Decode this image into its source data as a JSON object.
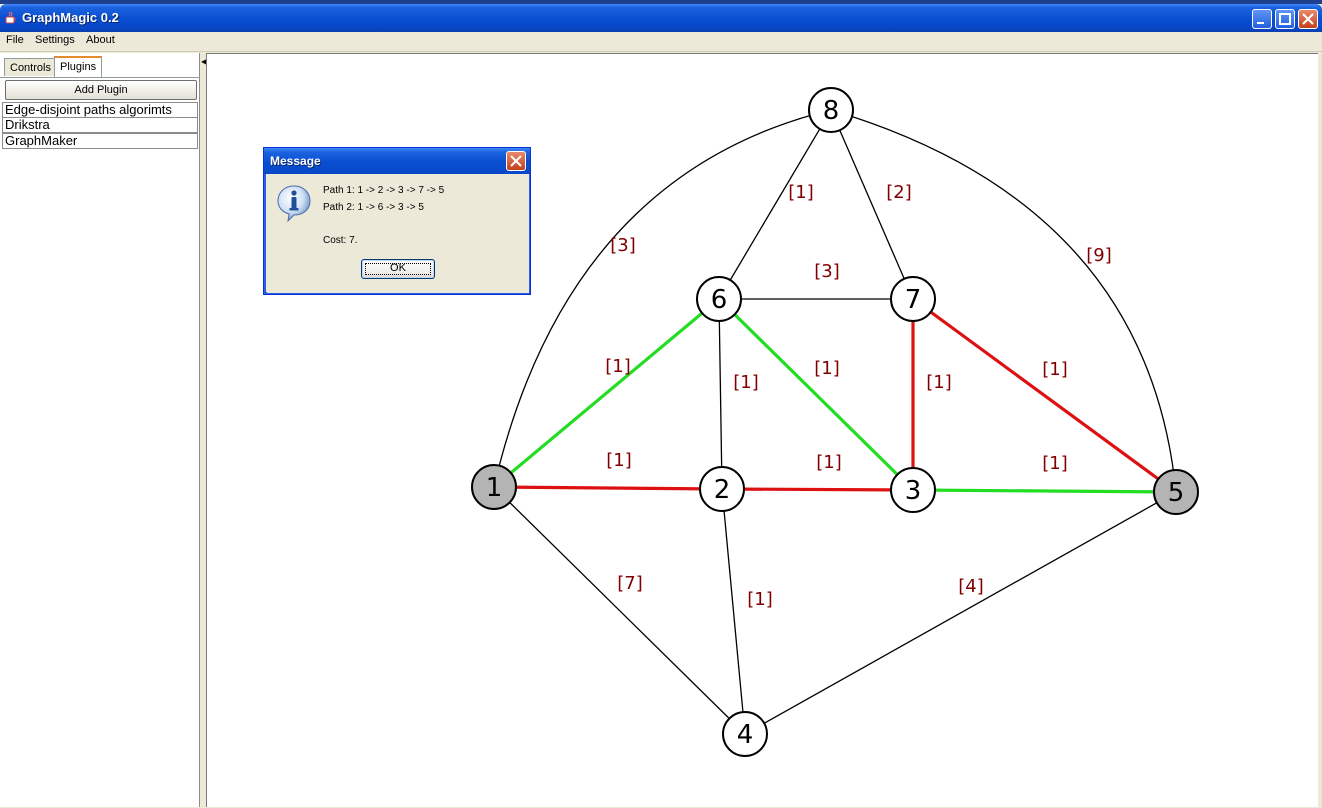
{
  "window": {
    "title": "GraphMagic 0.2"
  },
  "menubar": {
    "items": [
      "File",
      "Settings",
      "About"
    ]
  },
  "left_panel": {
    "tabs": [
      "Controls",
      "Plugins"
    ],
    "active_tab": "Plugins",
    "add_plugin_label": "Add Plugin",
    "plugins": [
      "Edge-disjoint paths algorimts",
      "Drikstra",
      "GraphMaker"
    ]
  },
  "dialog": {
    "title": "Message",
    "icon": "info-icon",
    "lines": [
      "Path 1: 1 -> 2 -> 3 -> 7 -> 5",
      "Path 2: 1 -> 6 -> 3 -> 5",
      "Cost: 7."
    ],
    "ok_label": "OK"
  },
  "graph": {
    "nodes": [
      {
        "id": "1",
        "highlighted": true
      },
      {
        "id": "2",
        "highlighted": false
      },
      {
        "id": "3",
        "highlighted": false
      },
      {
        "id": "4",
        "highlighted": false
      },
      {
        "id": "5",
        "highlighted": true
      },
      {
        "id": "6",
        "highlighted": false
      },
      {
        "id": "7",
        "highlighted": false
      },
      {
        "id": "8",
        "highlighted": false
      }
    ],
    "edges": [
      {
        "from": "8",
        "to": "1",
        "weight": "[3]",
        "path": "none"
      },
      {
        "from": "8",
        "to": "5",
        "weight": "[9]",
        "path": "none"
      },
      {
        "from": "8",
        "to": "6",
        "weight": "[1]",
        "path": "none"
      },
      {
        "from": "8",
        "to": "7",
        "weight": "[2]",
        "path": "none"
      },
      {
        "from": "6",
        "to": "7",
        "weight": "[3]",
        "path": "none"
      },
      {
        "from": "1",
        "to": "6",
        "weight": "[1]",
        "path": "path2"
      },
      {
        "from": "6",
        "to": "2",
        "weight": "[1]",
        "path": "none"
      },
      {
        "from": "6",
        "to": "3",
        "weight": "[1]",
        "path": "path2"
      },
      {
        "from": "7",
        "to": "3",
        "weight": "[1]",
        "path": "path1"
      },
      {
        "from": "7",
        "to": "5",
        "weight": "[1]",
        "path": "path1"
      },
      {
        "from": "1",
        "to": "2",
        "weight": "[1]",
        "path": "path1"
      },
      {
        "from": "2",
        "to": "3",
        "weight": "[1]",
        "path": "path1"
      },
      {
        "from": "3",
        "to": "5",
        "weight": "[1]",
        "path": "path2"
      },
      {
        "from": "1",
        "to": "4",
        "weight": "[7]",
        "path": "none"
      },
      {
        "from": "2",
        "to": "4",
        "weight": "[1]",
        "path": "none"
      },
      {
        "from": "5",
        "to": "4",
        "weight": "[4]",
        "path": "none"
      }
    ],
    "colors": {
      "path1": "#dd1111",
      "path2": "#22dd22",
      "none": "#000000",
      "highlighted_node": "#b4b4b4",
      "node": "#ffffff",
      "label": "#7f0000"
    }
  }
}
